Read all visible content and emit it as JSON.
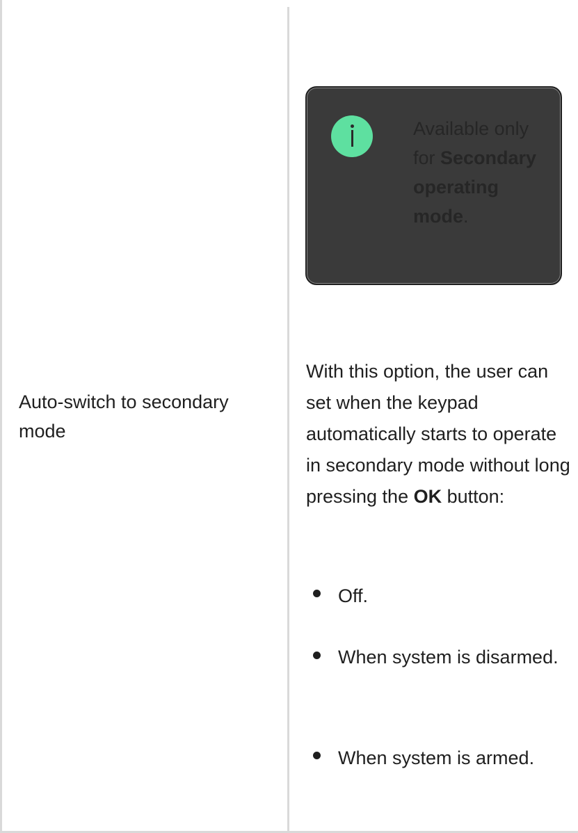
{
  "info_box": {
    "icon": "info-icon",
    "icon_color": "#5ee0a0",
    "text_prefix": "Available only for ",
    "text_bold": "Secondary operating mode",
    "text_suffix": "."
  },
  "row": {
    "label": "Auto-switch to secondary mode",
    "description_prefix": "With this option, the user can set when the keypad automatically starts to operate in secondary mode without long pressing the ",
    "description_bold": "OK",
    "description_suffix": " button:",
    "options": [
      "Off.",
      "When system is disarmed.",
      "When system is armed."
    ]
  }
}
